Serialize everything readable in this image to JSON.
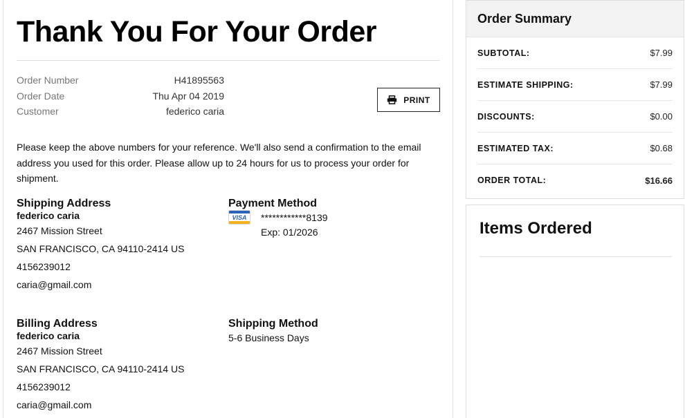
{
  "page": {
    "title": "Thank You For Your Order"
  },
  "order_meta": [
    {
      "label": "Order Number",
      "value": "H41895563"
    },
    {
      "label": "Order Date",
      "value": "Thu Apr 04 2019"
    },
    {
      "label": "Customer",
      "value": "federico caria"
    }
  ],
  "print_button": {
    "label": "PRINT",
    "icon": "printer-icon"
  },
  "notice": "Please keep the above numbers for your reference. We'll also send a confirmation to the email address you used for this order. Please allow up to 24 hours for us to process your order for shipment.",
  "shipping_address": {
    "heading": "Shipping Address",
    "name": "federico caria",
    "street": "2467 Mission Street",
    "city": "SAN FRANCISCO, CA 94110-2414 US",
    "phone": "4156239012",
    "email": "caria@gmail.com"
  },
  "billing_address": {
    "heading": "Billing Address",
    "name": "federico caria",
    "street": "2467 Mission Street",
    "city": "SAN FRANCISCO, CA 94110-2414 US",
    "phone": "4156239012",
    "email": "caria@gmail.com"
  },
  "payment": {
    "heading": "Payment Method",
    "card_brand": "VISA",
    "card_number": "************8139",
    "expiry": "Exp: 01/2026"
  },
  "shipping_method": {
    "heading": "Shipping Method",
    "value": "5-6 Business Days"
  },
  "summary": {
    "title": "Order Summary",
    "rows": [
      {
        "label": "SUBTOTAL:",
        "amount": "$7.99"
      },
      {
        "label": "ESTIMATE SHIPPING:",
        "amount": "$7.99"
      },
      {
        "label": "DISCOUNTS:",
        "amount": "$0.00"
      },
      {
        "label": "ESTIMATED TAX:",
        "amount": "$0.68"
      },
      {
        "label": "ORDER TOTAL:",
        "amount": "$16.66"
      }
    ]
  },
  "items": {
    "title": "Items Ordered"
  },
  "colors": {
    "visa_blue": "#2b62ba",
    "visa_gold": "#f2b21b",
    "summary_header_bg": "#f3f3f3"
  }
}
